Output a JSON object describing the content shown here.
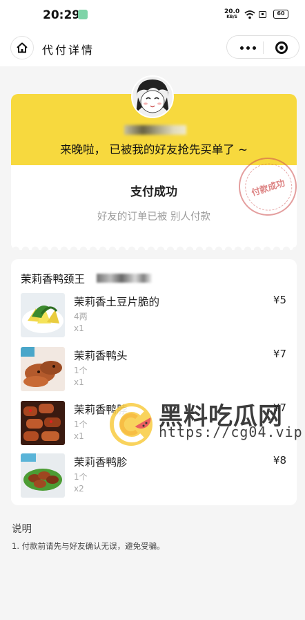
{
  "status_bar": {
    "time": "20:29",
    "net_speed": "20.0",
    "net_unit": "KB/S",
    "battery": "60"
  },
  "nav": {
    "title": "代付详情"
  },
  "status_card": {
    "notice": "来晚啦， 已被我的好友抢先买单了 ~",
    "paid_title": "支付成功",
    "paid_sub": "好友的订单已被 别人付款",
    "stamp_text": "付款成功"
  },
  "order": {
    "shop_name": "茉莉香鸭颈王",
    "items": [
      {
        "name": "茉莉香土豆片脆的",
        "spec": "4两",
        "qty": "x1",
        "price": "¥5"
      },
      {
        "name": "茉莉香鸭头",
        "spec": "1个",
        "qty": "x1",
        "price": "¥7"
      },
      {
        "name": "茉莉香鸭脖",
        "spec": "1个",
        "qty": "x1",
        "price": "¥7"
      },
      {
        "name": "茉莉香鸭胗",
        "spec": "1个",
        "qty": "x2",
        "price": "¥8"
      }
    ]
  },
  "watermark": {
    "title": "黑料吃瓜网",
    "url": "https://cg04.vip"
  },
  "notes": {
    "title": "说明",
    "line1": "1. 付款前请先与好友确认无误，避免受骗。"
  }
}
